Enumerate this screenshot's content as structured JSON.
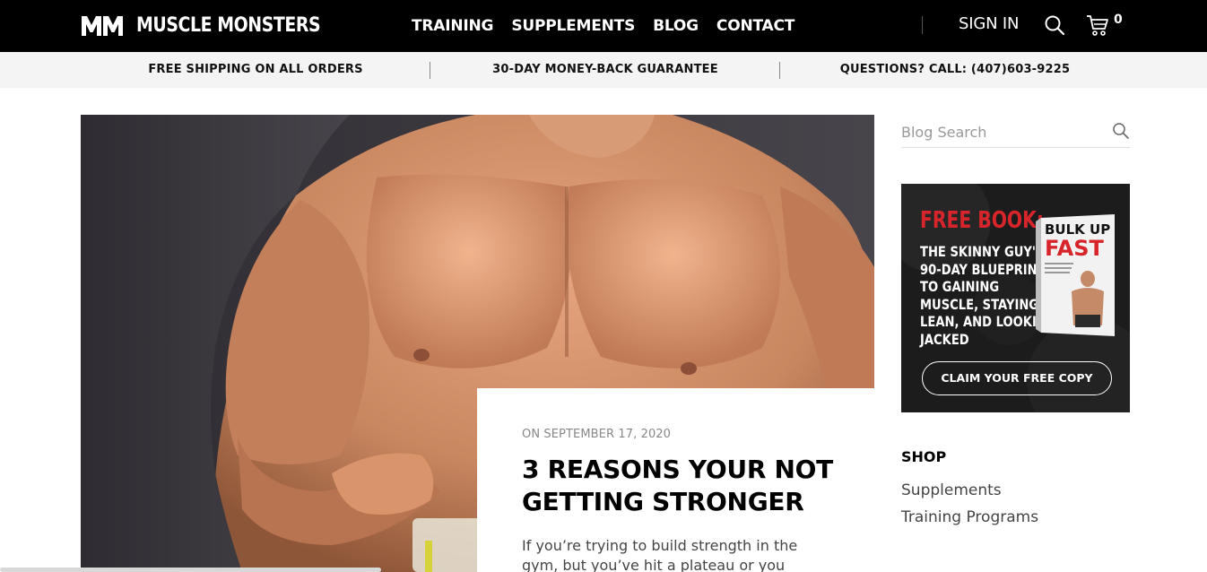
{
  "header": {
    "logo_text": "MUSCLE MONSTERS",
    "nav": [
      "TRAINING",
      "SUPPLEMENTS",
      "BLOG",
      "CONTACT"
    ],
    "sign_in": "SIGN IN",
    "cart_count": "0",
    "icons": {
      "search": "search-icon",
      "cart": "cart-icon",
      "logo": "mm-logo"
    }
  },
  "promo_bar": {
    "items": [
      "FREE SHIPPING ON ALL ORDERS",
      "30-DAY MONEY-BACK GUARANTEE",
      "QUESTIONS? CALL: (407)603-9225"
    ]
  },
  "post": {
    "date": "ON SEPTEMBER 17, 2020",
    "title": "3 REASONS YOUR NOT GETTING STRONGER",
    "excerpt": "If you’re trying to build strength in the gym, but you’ve hit a plateau or you"
  },
  "sidebar": {
    "search_placeholder": "Blog Search",
    "ad": {
      "headline": "FREE BOOK:",
      "lines": [
        "THE SKINNY GUY'S",
        "90-DAY BLUEPRINT",
        "TO GAINING",
        "MUSCLE, STAYING",
        "LEAN, AND LOOKING",
        "JACKED"
      ],
      "book_title_1": "BULK UP",
      "book_title_2": "FAST",
      "cta": "CLAIM YOUR FREE COPY"
    },
    "shop_heading": "SHOP",
    "shop_links": [
      "Supplements",
      "Training Programs"
    ]
  },
  "colors": {
    "header_bg": "#000000",
    "promo_bg": "#f4f4f4",
    "accent_red": "#d8252b"
  }
}
